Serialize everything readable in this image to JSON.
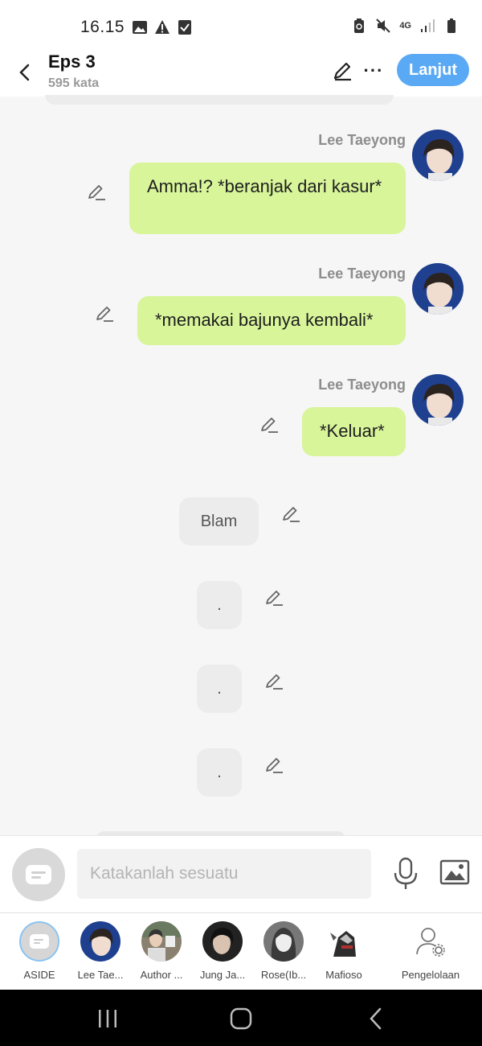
{
  "status_bar": {
    "time": "16.15",
    "network": "4G"
  },
  "header": {
    "title": "Eps 3",
    "subtitle": "595 kata",
    "more_label": "···",
    "next_label": "Lanjut",
    "accent_color": "#5aa9f5"
  },
  "messages": [
    {
      "type": "character",
      "sender": "Lee Taeyong",
      "text": "Amma!? *beranjak dari kasur*"
    },
    {
      "type": "character",
      "sender": "Lee Taeyong",
      "text": "*memakai bajunya kembali*"
    },
    {
      "type": "character",
      "sender": "Lee Taeyong",
      "text": "*Keluar*"
    },
    {
      "type": "narration",
      "text": "Blam"
    },
    {
      "type": "narration",
      "text": "."
    },
    {
      "type": "narration",
      "text": "."
    },
    {
      "type": "narration",
      "text": "."
    }
  ],
  "composer": {
    "placeholder": "Katakanlah sesuatu"
  },
  "characters": [
    {
      "name": "ASIDE"
    },
    {
      "name": "Lee Tae..."
    },
    {
      "name": "Author ..."
    },
    {
      "name": "Jung Ja..."
    },
    {
      "name": "Rose(Ib..."
    },
    {
      "name": "Mafioso"
    },
    {
      "name": "Pengelolaan"
    }
  ],
  "colors": {
    "bubble_right": "#d8f59a",
    "bubble_narration": "#ececec",
    "background": "#f6f6f6"
  }
}
